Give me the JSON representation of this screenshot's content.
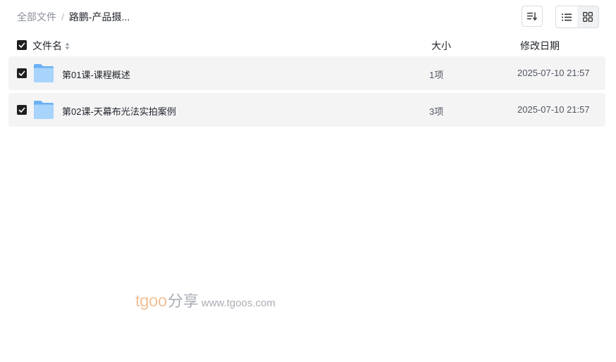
{
  "breadcrumb": {
    "root": "全部文件",
    "separator": "/",
    "current": "路鹏-产品摄..."
  },
  "toolbar": {
    "sort_icon": "sort-lines-icon",
    "list_view_icon": "list-view-icon",
    "grid_view_icon": "grid-view-icon"
  },
  "table": {
    "headers": {
      "name": "文件名",
      "size": "大小",
      "date": "修改日期"
    },
    "rows": [
      {
        "name": "第01课-课程概述",
        "size": "1项",
        "date": "2025-07-10 21:57",
        "checked": true,
        "icon": "folder-icon"
      },
      {
        "name": "第02课-天幕布光法实拍案例",
        "size": "3项",
        "date": "2025-07-10 21:57",
        "checked": true,
        "icon": "folder-icon"
      }
    ]
  },
  "watermark": {
    "brand": "tgoo",
    "cn": "分享",
    "url": "www.tgoos.com"
  },
  "colors": {
    "folder_light": "#a8d3fb",
    "folder_dark": "#6ab0f3",
    "row_bg": "#f4f4f5",
    "checkbox": "#1f1f1f"
  }
}
